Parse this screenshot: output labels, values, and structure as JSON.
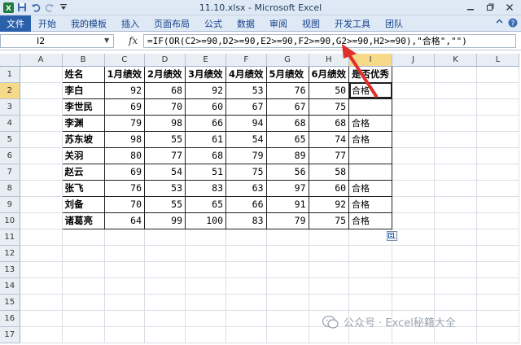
{
  "window": {
    "title": "11.10.xlsx - Microsoft Excel"
  },
  "ribbon": {
    "file_tab": "文件",
    "tabs": [
      "开始",
      "我的模板",
      "插入",
      "页面布局",
      "公式",
      "数据",
      "审阅",
      "视图",
      "开发工具",
      "团队"
    ]
  },
  "formula_bar": {
    "cell_ref": "I2",
    "fx_label": "fx",
    "formula": "=IF(OR(C2>=90,D2>=90,E2>=90,F2>=90,G2>=90,H2>=90),\"合格\",\"\")"
  },
  "columns": [
    "A",
    "B",
    "C",
    "D",
    "E",
    "F",
    "G",
    "H",
    "I",
    "J",
    "K",
    "L"
  ],
  "row_numbers": [
    "1",
    "2",
    "3",
    "4",
    "5",
    "6",
    "7",
    "8",
    "9",
    "10",
    "11",
    "12",
    "13",
    "14",
    "15",
    "16",
    "17"
  ],
  "table": {
    "headers": [
      "姓名",
      "1月绩效",
      "2月绩效",
      "3月绩效",
      "4月绩效",
      "5月绩效",
      "6月绩效",
      "是否优秀"
    ],
    "rows": [
      [
        "李白",
        "92",
        "68",
        "92",
        "53",
        "76",
        "50",
        "合格"
      ],
      [
        "李世民",
        "69",
        "70",
        "60",
        "67",
        "67",
        "75",
        ""
      ],
      [
        "李渊",
        "79",
        "98",
        "66",
        "94",
        "68",
        "68",
        "合格"
      ],
      [
        "苏东坡",
        "98",
        "55",
        "61",
        "54",
        "65",
        "74",
        "合格"
      ],
      [
        "关羽",
        "80",
        "77",
        "68",
        "79",
        "89",
        "77",
        ""
      ],
      [
        "赵云",
        "69",
        "54",
        "51",
        "75",
        "56",
        "58",
        ""
      ],
      [
        "张飞",
        "76",
        "53",
        "83",
        "63",
        "97",
        "60",
        "合格"
      ],
      [
        "刘备",
        "70",
        "55",
        "65",
        "66",
        "91",
        "92",
        "合格"
      ],
      [
        "诸葛亮",
        "64",
        "99",
        "100",
        "83",
        "79",
        "75",
        "合格"
      ]
    ]
  },
  "selection": {
    "active_column": "I",
    "active_row": "2"
  },
  "watermark": {
    "text": "公众号 · Excel秘籍大全"
  },
  "colors": {
    "file_tab": "#2a5fa9",
    "ribbon_bg": "#dfe9f5",
    "header_bg": "#e9eef5",
    "selected_header": "#f7d98a",
    "arrow": "#e0302a"
  }
}
